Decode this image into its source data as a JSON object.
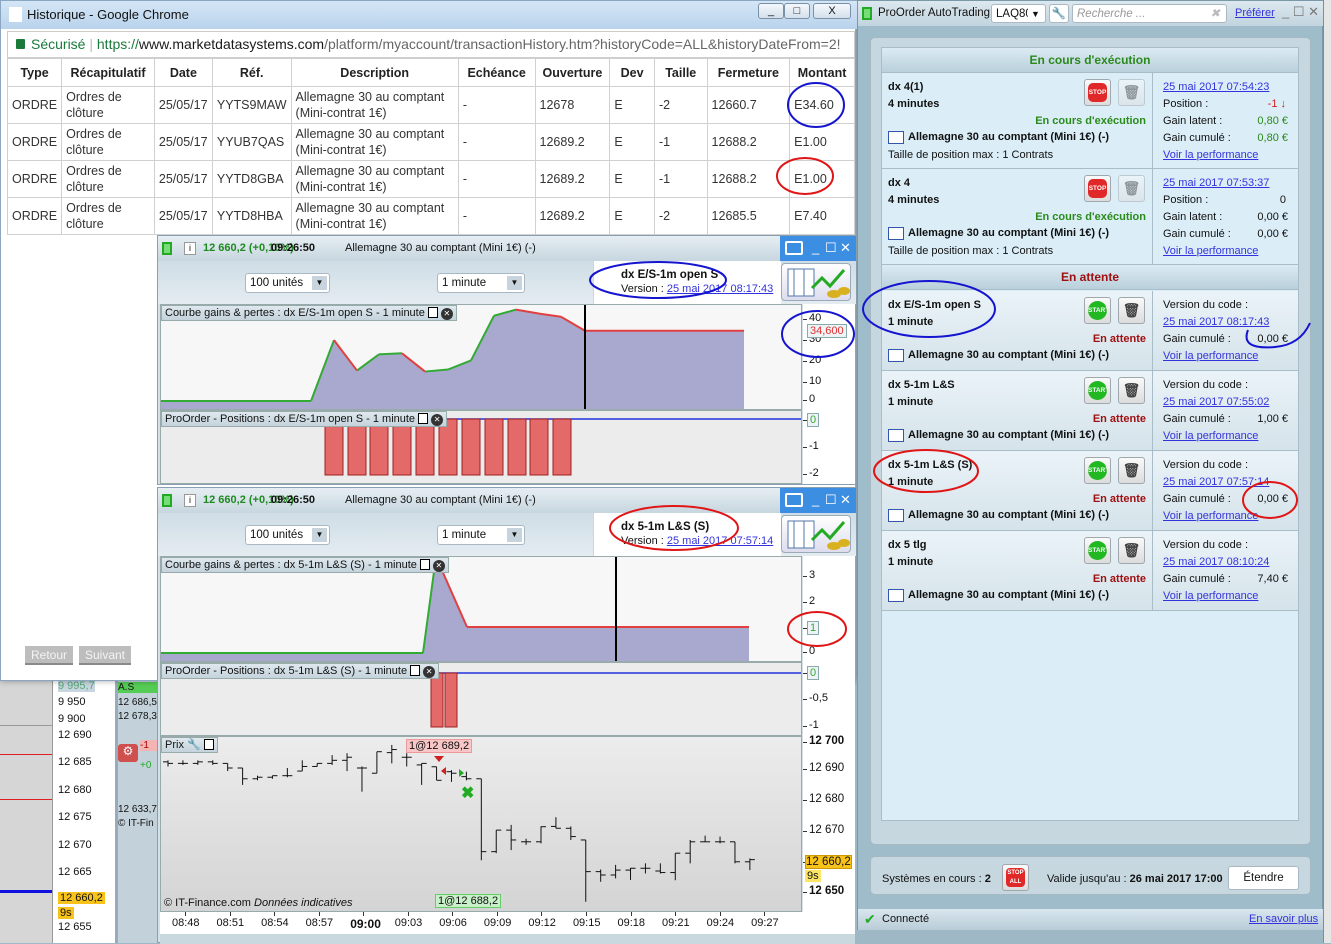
{
  "browser": {
    "title": "Historique - Google Chrome",
    "secure_label": "Sécurisé",
    "url_scheme": "https://",
    "url_domain": "www.marketdatasystems.com",
    "url_path": "/platform/myaccount/transactionHistory.htm?historyCode=ALL&historyDateFrom=2!"
  },
  "history": {
    "columns": [
      "Type",
      "Récapitulatif",
      "Date",
      "Réf.",
      "Description",
      "Echéance",
      "Ouverture",
      "Dev",
      "Taille",
      "Fermeture",
      "Montant"
    ],
    "rows": [
      [
        "ORDRE",
        "Ordres de clôture",
        "25/05/17",
        "YYTS9MAW",
        "Allemagne 30 au comptant (Mini-contrat 1€)",
        "-",
        "12678",
        "E",
        "-2",
        "12660.7",
        "E34.60"
      ],
      [
        "ORDRE",
        "Ordres de clôture",
        "25/05/17",
        "YYUB7QAS",
        "Allemagne 30 au comptant (Mini-contrat 1€)",
        "-",
        "12689.2",
        "E",
        "-1",
        "12688.2",
        "E1.00"
      ],
      [
        "ORDRE",
        "Ordres de clôture",
        "25/05/17",
        "YYTD8GBA",
        "Allemagne 30 au comptant (Mini-contrat 1€)",
        "-",
        "12689.2",
        "E",
        "-1",
        "12688.2",
        "E1.00"
      ],
      [
        "ORDRE",
        "Ordres de clôture",
        "25/05/17",
        "YYTD8HBA",
        "Allemagne 30 au comptant (Mini-contrat 1€)",
        "-",
        "12689.2",
        "E",
        "-2",
        "12685.5",
        "E7.40"
      ]
    ],
    "back_label": "Retour",
    "next_label": "Suivant"
  },
  "chart_windows": [
    {
      "quote": "12 660,2 (+0,10%)",
      "time": "09:26:50",
      "instrument": "Allemagne 30 au comptant (Mini 1€) (-)",
      "units": "100 unités",
      "timeframe": "1 minute",
      "system_name": "dx E/S-1m open S",
      "version_label": "Version : ",
      "version_date": "25 mai 2017 08:17:43",
      "gains_title": "Courbe gains & pertes : dx E/S-1m open S - 1 minute",
      "positions_title": "ProOrder - Positions : dx E/S-1m open S - 1 minute",
      "gains_current": "34,600",
      "positions_current": "0"
    },
    {
      "quote": "12 660,2 (+0,10%)",
      "time": "09:26:50",
      "instrument": "Allemagne 30 au comptant (Mini 1€) (-)",
      "units": "100 unités",
      "timeframe": "1 minute",
      "system_name": "dx 5-1m L&S (S)",
      "version_label": "Version : ",
      "version_date": "25 mai 2017 07:57:14",
      "gains_title": "Courbe gains & pertes : dx 5-1m L&S (S) - 1 minute",
      "positions_title": "ProOrder - Positions : dx 5-1m L&S (S) - 1 minute",
      "gains_current": "1",
      "positions_current": "0",
      "price_title": "Prix",
      "copyright": "© IT-Finance.com",
      "disclaimer": "Données indicatives",
      "sell_marker": "1@12 689,2",
      "buy_marker": "1@12 688,2",
      "last_price": "12 660,2",
      "countdown": "9s"
    }
  ],
  "chart_data": [
    {
      "type": "area",
      "title": "Courbe gains & pertes : dx E/S-1m open S - 1 minute",
      "values": [
        0,
        0,
        30,
        15,
        23,
        23.5,
        14.5,
        15.5,
        20,
        42,
        45,
        43,
        41.5,
        34.6,
        34.6
      ],
      "yticks": [
        "40",
        "30",
        "20",
        "10",
        "0"
      ],
      "ylim": [
        0,
        45
      ],
      "up_color": "#33aa33",
      "down_color": "#e04040",
      "fill": "#a9a9d0"
    },
    {
      "type": "bar",
      "title": "ProOrder - Positions : dx E/S-1m open S - 1 minute",
      "values": [
        -2,
        -2,
        -2,
        -2,
        -2,
        -2,
        -2,
        -2,
        -2,
        -2,
        -2
      ],
      "yticks": [
        "0",
        "-1",
        "-2"
      ],
      "ylim": [
        -2,
        0
      ]
    },
    {
      "type": "area",
      "title": "Courbe gains & pertes : dx 5-1m L&S (S) - 1 minute",
      "values": [
        0,
        0,
        3.7,
        1,
        1
      ],
      "yticks": [
        "3",
        "2",
        "1",
        "0"
      ],
      "ylim": [
        0,
        3.5
      ]
    },
    {
      "type": "bar",
      "title": "ProOrder - Positions : dx 5-1m L&S (S) - 1 minute",
      "values": [
        -1,
        -1
      ],
      "yticks": [
        "0",
        "-0,5",
        "-1"
      ],
      "ylim": [
        -1,
        0
      ]
    },
    {
      "type": "ohlc",
      "title": "Prix",
      "yticks": [
        "12 700",
        "12 690",
        "12 680",
        "12 670",
        "12 660,2",
        "12 650"
      ],
      "ylim": [
        12645,
        12700
      ],
      "xticks": [
        "08:48",
        "08:51",
        "08:54",
        "08:57",
        "09:00",
        "09:03",
        "09:06",
        "09:09",
        "09:12",
        "09:15",
        "09:18",
        "09:21",
        "09:24",
        "09:27"
      ],
      "bars": [
        [
          12692,
          12692.5,
          12690.5,
          12691.5
        ],
        [
          12691.5,
          12692.5,
          12691,
          12691.5
        ],
        [
          12691.5,
          12692.5,
          12691,
          12692
        ],
        [
          12692,
          12692.5,
          12691,
          12691.5
        ],
        [
          12691.5,
          12691.5,
          12689,
          12690
        ],
        [
          12690,
          12690,
          12684.5,
          12686.5
        ],
        [
          12686.5,
          12687.5,
          12686,
          12687
        ],
        [
          12687,
          12687.5,
          12686.5,
          12687.5
        ],
        [
          12687.5,
          12690,
          12687,
          12687.5
        ],
        [
          12689,
          12692.5,
          12689,
          12690.5
        ],
        [
          12690.5,
          12691.5,
          12690.5,
          12691.5
        ],
        [
          12691.5,
          12694.2,
          12691,
          12692.5
        ],
        [
          12692.5,
          12694.8,
          12689,
          12693.5
        ],
        [
          12690,
          12690.5,
          12682.3,
          12690
        ],
        [
          12688.3,
          12695.3,
          12688.3,
          12695.3
        ],
        [
          12695,
          12697.5,
          12691.5,
          12696
        ],
        [
          12693.5,
          12694.8,
          12690.5,
          12693.5
        ],
        [
          12691,
          12691.5,
          12684.5,
          12691.5
        ],
        [
          12690.4,
          12690.4,
          12686,
          12686
        ],
        [
          12688.8,
          12689.3,
          12685.5,
          12688.3
        ],
        [
          12687.2,
          12688.8,
          12686,
          12686.5
        ],
        [
          12686.5,
          12686.5,
          12660,
          12662.8
        ],
        [
          12662.8,
          12669.8,
          12662.3,
          12669.8
        ],
        [
          12669.8,
          12671.5,
          12663.3,
          12666.6
        ],
        [
          12666,
          12667,
          12665,
          12666
        ],
        [
          12666,
          12671,
          12665.5,
          12670.9
        ],
        [
          12671,
          12674,
          12670.4,
          12670.4
        ],
        [
          12670.4,
          12671,
          12666.6,
          12667.7
        ],
        [
          12666.6,
          12666.6,
          12646.5,
          12656.3
        ],
        [
          12656.3,
          12657,
          12653,
          12655.2
        ],
        [
          12655.2,
          12658.5,
          12654.1,
          12656.8
        ],
        [
          12656.8,
          12657.5,
          12653.6,
          12657.4
        ],
        [
          12657.4,
          12659,
          12655.7,
          12657.4
        ],
        [
          12656.5,
          12659,
          12655.7,
          12656
        ],
        [
          12656,
          12662.3,
          12653.5,
          12662.3
        ],
        [
          12662.3,
          12666.6,
          12659,
          12666
        ],
        [
          12666,
          12668,
          12666,
          12666
        ],
        [
          12666,
          12667.7,
          12665.5,
          12666
        ],
        [
          12666,
          12666,
          12659,
          12659.5
        ],
        [
          12659.5,
          12660.6,
          12656.8,
          12660.2
        ]
      ]
    }
  ],
  "background_chart": {
    "ticks": [
      "9 995,7",
      "9 950",
      "9 900",
      "12 690",
      "12 685",
      "12 680",
      "12 675",
      "12 670",
      "12 665",
      "12 660,2",
      "9s",
      "12 655"
    ],
    "strip": [
      "A.S",
      "12 686,5",
      "12 678,3",
      "-1",
      "+0",
      "12 633,7",
      "© IT-Fin"
    ]
  },
  "autotrading": {
    "title": "ProOrder AutoTrading",
    "account": "LAQ80",
    "search_placeholder": "Recherche ...",
    "prefer_label": "Préférer",
    "running_header": "En cours d'exécution",
    "pending_header": "En attente",
    "running": [
      {
        "name": "dx 4(1)",
        "period": "4 minutes",
        "status": "En cours d'exécution",
        "instrument": "Allemagne 30 au comptant (Mini 1€) (-)",
        "max_size": "Taille de position max : 1 Contrats",
        "date": "25 mai 2017 07:54:23",
        "position_label": "Position :",
        "position": "-1",
        "latent_label": "Gain latent :",
        "latent": "0,80 €",
        "cumul_label": "Gain cumulé :",
        "cumul": "0,80 €",
        "perf": "Voir la performance",
        "button": "STOP"
      },
      {
        "name": "dx 4",
        "period": "4 minutes",
        "status": "En cours d'exécution",
        "instrument": "Allemagne 30 au comptant (Mini 1€) (-)",
        "max_size": "Taille de position max : 1 Contrats",
        "date": "25 mai 2017 07:53:37",
        "position_label": "Position :",
        "position": "0",
        "latent_label": "Gain latent :",
        "latent": "0,00 €",
        "cumul_label": "Gain cumulé :",
        "cumul": "0,00 €",
        "perf": "Voir la performance",
        "button": "STOP"
      }
    ],
    "pending": [
      {
        "name": "dx E/S-1m open S",
        "period": "1 minute",
        "status": "En attente",
        "instrument": "Allemagne 30 au comptant (Mini 1€) (-)",
        "version_label": "Version du code :",
        "date": "25 mai 2017 08:17:43",
        "cumul_label": "Gain cumulé :",
        "cumul": "0,00 €",
        "perf": "Voir la performance",
        "button": "START"
      },
      {
        "name": "dx 5-1m L&S",
        "period": "1 minute",
        "status": "En attente",
        "instrument": "Allemagne 30 au comptant (Mini 1€) (-)",
        "version_label": "Version du code :",
        "date": "25 mai 2017 07:55:02",
        "cumul_label": "Gain cumulé :",
        "cumul": "1,00 €",
        "perf": "Voir la performance",
        "button": "START"
      },
      {
        "name": "dx 5-1m L&S (S)",
        "period": "1 minute",
        "status": "En attente",
        "instrument": "Allemagne 30 au comptant (Mini 1€) (-)",
        "version_label": "Version du code :",
        "date": "25 mai 2017 07:57:14",
        "cumul_label": "Gain cumulé :",
        "cumul": "0,00 €",
        "perf": "Voir la performance",
        "button": "START"
      },
      {
        "name": "dx 5 tlg",
        "period": "1 minute",
        "status": "En attente",
        "instrument": "Allemagne 30 au comptant (Mini 1€) (-)",
        "version_label": "Version du code :",
        "date": "25 mai 2017 08:10:24",
        "cumul_label": "Gain cumulé :",
        "cumul": "7,40 €",
        "perf": "Voir la performance",
        "button": "START"
      }
    ],
    "systems_label": "Systèmes en cours :",
    "systems_count": "2",
    "stop_all": "STOP ALL",
    "valid_label": "Valide jusqu'au :",
    "valid_date": "26 mai 2017 17:00",
    "extend_label": "Étendre",
    "connected": "Connecté",
    "learn_more": "En savoir plus"
  },
  "colors": {
    "running": "#2a8a1a",
    "pending": "#a01010",
    "link": "#3333dd",
    "area_fill": "#a9a9d0",
    "position_bar": "#e46a6a",
    "last_price_bg": "#f7c21a"
  }
}
